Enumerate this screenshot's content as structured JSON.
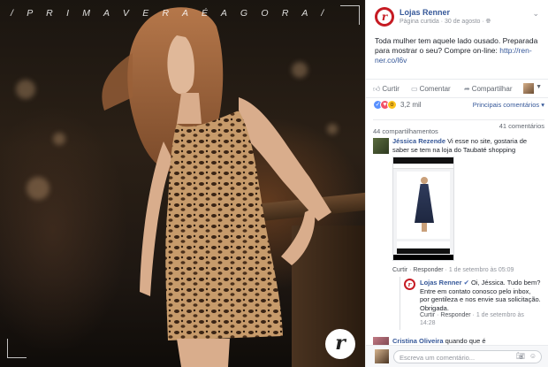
{
  "photo": {
    "caption": "/ P R I M A V E R A É A G O R A /",
    "logo_letter": "r"
  },
  "post": {
    "page_name": "Lojas Renner",
    "page_avatar_letter": "r",
    "meta": "Página curtida · 30 de agosto · ",
    "text": "Toda mulher tem aquele lado ousado. Preparada para mostrar o seu? Compre on-line: ",
    "link": "http://ren-ner.co/l6v"
  },
  "actions": {
    "like": "Curtir",
    "comment": "Comentar",
    "share": "Compartilhar"
  },
  "reactions": {
    "count": "3,2 mil",
    "sort_label": "Principais comentários"
  },
  "counts": {
    "shares": "44 compartilhamentos",
    "comments": "41 comentários"
  },
  "comments": [
    {
      "name": "Jéssica Rezende",
      "text": " Vi esse no site, gostaria de saber se tem na loja do Taubaté shopping",
      "like": "Curtir",
      "reply": "Responder",
      "time": "1 de setembro às 05:09"
    },
    {
      "name": "Lojas Renner",
      "text": " Oi, Jéssica. Tudo bem? Entre em contato conosco pelo inbox, por gentileza e nos envie sua solicitação. Obrigada.",
      "like": "Curtir",
      "reply": "Responder",
      "time": "1 de setembro às 14:28"
    },
    {
      "name": "Cristina Oliveira",
      "text": " quando que é"
    }
  ],
  "reply_box": {
    "placeholder": "Escreva um comentário..."
  },
  "colors": {
    "link": "#365899",
    "brand_red": "#c61b23"
  }
}
